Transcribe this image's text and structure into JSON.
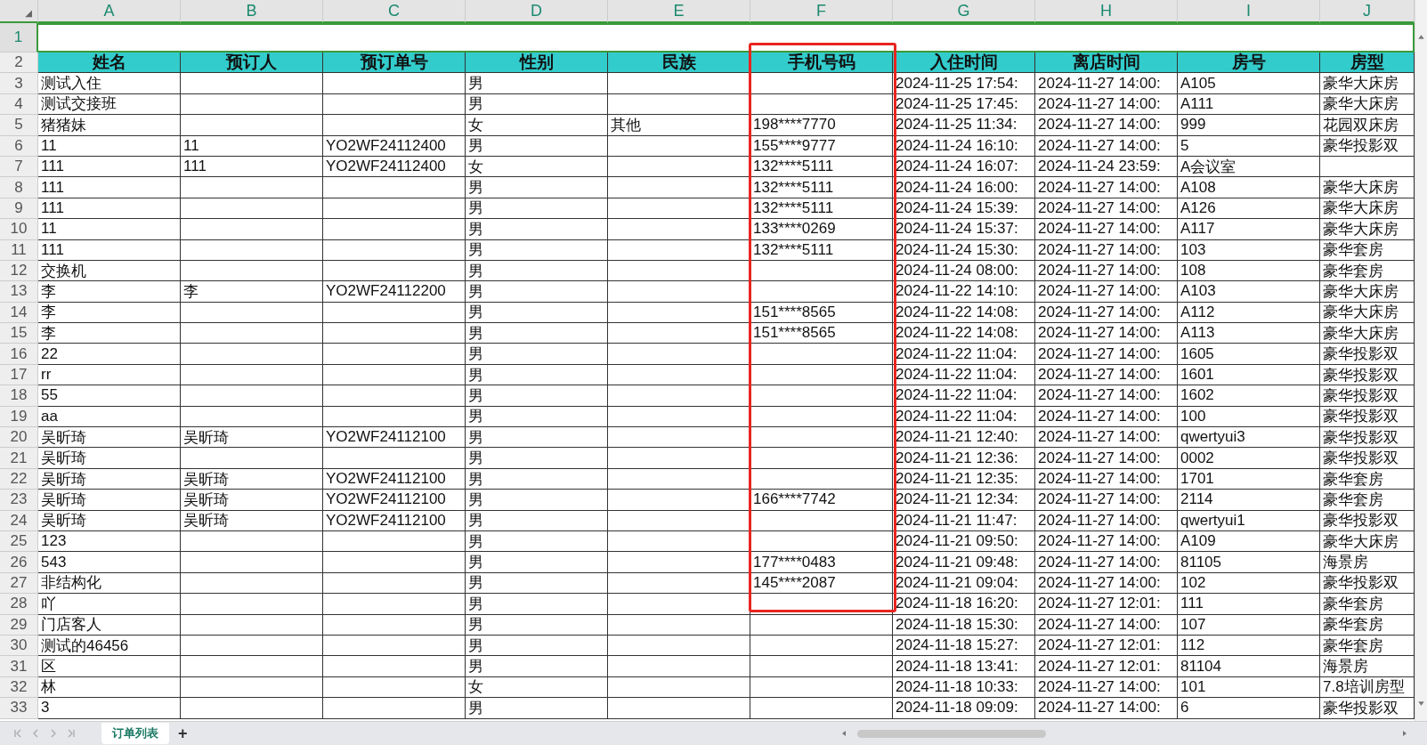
{
  "corner": "◢",
  "column_letters": [
    {
      "label": "A"
    },
    {
      "label": "B"
    },
    {
      "label": "C"
    },
    {
      "label": "D"
    },
    {
      "label": "E"
    },
    {
      "label": "F"
    },
    {
      "label": "G"
    },
    {
      "label": "H"
    },
    {
      "label": "I"
    },
    {
      "label": "J"
    }
  ],
  "headers": [
    {
      "label": "姓名"
    },
    {
      "label": "预订人"
    },
    {
      "label": "预订单号"
    },
    {
      "label": "性别"
    },
    {
      "label": "民族"
    },
    {
      "label": "手机号码"
    },
    {
      "label": "入住时间"
    },
    {
      "label": "离店时间"
    },
    {
      "label": "房号"
    },
    {
      "label": "房型"
    }
  ],
  "header_row_number": "2",
  "first_row_number": "1",
  "rows": [
    {
      "n": "3",
      "cells": [
        {
          "text": "测试入住"
        },
        {},
        {},
        {
          "text": "男"
        },
        {},
        {},
        {
          "text": "2024-11-25 17:54:"
        },
        {
          "text": "2024-11-27 14:00:"
        },
        {
          "text": "A105"
        },
        {
          "text": "豪华大床房"
        }
      ]
    },
    {
      "n": "4",
      "cells": [
        {
          "text": "测试交接班"
        },
        {},
        {},
        {
          "text": "男"
        },
        {},
        {},
        {
          "text": "2024-11-25 17:45:"
        },
        {
          "text": "2024-11-27 14:00:"
        },
        {
          "text": "A111"
        },
        {
          "text": "豪华大床房"
        }
      ]
    },
    {
      "n": "5",
      "cells": [
        {
          "text": "猪猪妹"
        },
        {},
        {},
        {
          "text": "女"
        },
        {
          "text": "其他"
        },
        {
          "text": "198****7770"
        },
        {
          "text": "2024-11-25 11:34:"
        },
        {
          "text": "2024-11-27 14:00:"
        },
        {
          "text": "999"
        },
        {
          "text": "花园双床房"
        }
      ]
    },
    {
      "n": "6",
      "cells": [
        {
          "text": "11"
        },
        {
          "text": "11"
        },
        {
          "text": "YO2WF24112400"
        },
        {
          "text": "男"
        },
        {},
        {
          "text": "155****9777"
        },
        {
          "text": "2024-11-24 16:10:"
        },
        {
          "text": "2024-11-27 14:00:"
        },
        {
          "text": "5"
        },
        {
          "text": "豪华投影双"
        }
      ]
    },
    {
      "n": "7",
      "cells": [
        {
          "text": "111"
        },
        {
          "text": "111"
        },
        {
          "text": "YO2WF24112400"
        },
        {
          "text": "女"
        },
        {},
        {
          "text": "132****5111"
        },
        {
          "text": "2024-11-24 16:07:"
        },
        {
          "text": "2024-11-24 23:59:"
        },
        {
          "text": "A会议室"
        },
        {}
      ]
    },
    {
      "n": "8",
      "cells": [
        {
          "text": "111"
        },
        {},
        {},
        {
          "text": "男"
        },
        {},
        {
          "text": "132****5111"
        },
        {
          "text": "2024-11-24 16:00:"
        },
        {
          "text": "2024-11-27 14:00:"
        },
        {
          "text": "A108"
        },
        {
          "text": "豪华大床房"
        }
      ]
    },
    {
      "n": "9",
      "cells": [
        {
          "text": "111"
        },
        {},
        {},
        {
          "text": "男"
        },
        {},
        {
          "text": "132****5111"
        },
        {
          "text": "2024-11-24 15:39:"
        },
        {
          "text": "2024-11-27 14:00:"
        },
        {
          "text": "A126"
        },
        {
          "text": "豪华大床房"
        }
      ]
    },
    {
      "n": "10",
      "cells": [
        {
          "text": "11"
        },
        {},
        {},
        {
          "text": "男"
        },
        {},
        {
          "text": "133****0269"
        },
        {
          "text": "2024-11-24 15:37:"
        },
        {
          "text": "2024-11-27 14:00:"
        },
        {
          "text": "A117"
        },
        {
          "text": "豪华大床房"
        }
      ]
    },
    {
      "n": "11",
      "cells": [
        {
          "text": "111"
        },
        {},
        {},
        {
          "text": "男"
        },
        {},
        {
          "text": "132****5111"
        },
        {
          "text": "2024-11-24 15:30:"
        },
        {
          "text": "2024-11-27 14:00:"
        },
        {
          "text": "103"
        },
        {
          "text": "豪华套房"
        }
      ]
    },
    {
      "n": "12",
      "cells": [
        {
          "text": "交换机"
        },
        {},
        {},
        {
          "text": "男"
        },
        {},
        {},
        {
          "text": "2024-11-24 08:00:"
        },
        {
          "text": "2024-11-27 14:00:"
        },
        {
          "text": "108"
        },
        {
          "text": "豪华套房"
        }
      ]
    },
    {
      "n": "13",
      "cells": [
        {
          "text": "李"
        },
        {
          "text": "李"
        },
        {
          "text": "YO2WF24112200"
        },
        {
          "text": "男"
        },
        {},
        {},
        {
          "text": "2024-11-22 14:10:"
        },
        {
          "text": "2024-11-27 14:00:"
        },
        {
          "text": "A103"
        },
        {
          "text": "豪华大床房"
        }
      ]
    },
    {
      "n": "14",
      "cells": [
        {
          "text": "李"
        },
        {},
        {},
        {
          "text": "男"
        },
        {},
        {
          "text": "151****8565"
        },
        {
          "text": "2024-11-22 14:08:"
        },
        {
          "text": "2024-11-27 14:00:"
        },
        {
          "text": "A112"
        },
        {
          "text": "豪华大床房"
        }
      ]
    },
    {
      "n": "15",
      "cells": [
        {
          "text": "李"
        },
        {},
        {},
        {
          "text": "男"
        },
        {},
        {
          "text": "151****8565"
        },
        {
          "text": "2024-11-22 14:08:"
        },
        {
          "text": "2024-11-27 14:00:"
        },
        {
          "text": "A113"
        },
        {
          "text": "豪华大床房"
        }
      ]
    },
    {
      "n": "16",
      "cells": [
        {
          "text": "22"
        },
        {},
        {},
        {
          "text": "男"
        },
        {},
        {},
        {
          "text": "2024-11-22 11:04:"
        },
        {
          "text": "2024-11-27 14:00:"
        },
        {
          "text": "1605"
        },
        {
          "text": "豪华投影双"
        }
      ]
    },
    {
      "n": "17",
      "cells": [
        {
          "text": "rr"
        },
        {},
        {},
        {
          "text": "男"
        },
        {},
        {},
        {
          "text": "2024-11-22 11:04:"
        },
        {
          "text": "2024-11-27 14:00:"
        },
        {
          "text": "1601"
        },
        {
          "text": "豪华投影双"
        }
      ]
    },
    {
      "n": "18",
      "cells": [
        {
          "text": "55"
        },
        {},
        {},
        {
          "text": "男"
        },
        {},
        {},
        {
          "text": "2024-11-22 11:04:"
        },
        {
          "text": "2024-11-27 14:00:"
        },
        {
          "text": "1602"
        },
        {
          "text": "豪华投影双"
        }
      ]
    },
    {
      "n": "19",
      "cells": [
        {
          "text": "aa"
        },
        {},
        {},
        {
          "text": "男"
        },
        {},
        {},
        {
          "text": "2024-11-22 11:04:"
        },
        {
          "text": "2024-11-27 14:00:"
        },
        {
          "text": "100"
        },
        {
          "text": "豪华投影双"
        }
      ]
    },
    {
      "n": "20",
      "cells": [
        {
          "text": "吴昕琦"
        },
        {
          "text": "吴昕琦"
        },
        {
          "text": "YO2WF24112100"
        },
        {
          "text": "男"
        },
        {},
        {},
        {
          "text": "2024-11-21 12:40:"
        },
        {
          "text": "2024-11-27 14:00:"
        },
        {
          "text": "qwertyui3"
        },
        {
          "text": "豪华投影双"
        }
      ]
    },
    {
      "n": "21",
      "cells": [
        {
          "text": "吴昕琦"
        },
        {},
        {},
        {
          "text": "男"
        },
        {},
        {},
        {
          "text": "2024-11-21 12:36:"
        },
        {
          "text": "2024-11-27 14:00:"
        },
        {
          "text": "0002"
        },
        {
          "text": "豪华投影双"
        }
      ]
    },
    {
      "n": "22",
      "cells": [
        {
          "text": "吴昕琦"
        },
        {
          "text": "吴昕琦"
        },
        {
          "text": "YO2WF24112100"
        },
        {
          "text": "男"
        },
        {},
        {},
        {
          "text": "2024-11-21 12:35:"
        },
        {
          "text": "2024-11-27 14:00:"
        },
        {
          "text": "1701"
        },
        {
          "text": "豪华套房"
        }
      ]
    },
    {
      "n": "23",
      "cells": [
        {
          "text": "吴昕琦"
        },
        {
          "text": "吴昕琦"
        },
        {
          "text": "YO2WF24112100"
        },
        {
          "text": "男"
        },
        {},
        {
          "text": "166****7742"
        },
        {
          "text": "2024-11-21 12:34:"
        },
        {
          "text": "2024-11-27 14:00:"
        },
        {
          "text": "2114"
        },
        {
          "text": "豪华套房"
        }
      ]
    },
    {
      "n": "24",
      "cells": [
        {
          "text": "吴昕琦"
        },
        {
          "text": "吴昕琦"
        },
        {
          "text": "YO2WF24112100"
        },
        {
          "text": "男"
        },
        {},
        {},
        {
          "text": "2024-11-21 11:47:"
        },
        {
          "text": "2024-11-27 14:00:"
        },
        {
          "text": "qwertyui1"
        },
        {
          "text": "豪华投影双"
        }
      ]
    },
    {
      "n": "25",
      "cells": [
        {
          "text": "123"
        },
        {},
        {},
        {
          "text": "男"
        },
        {},
        {},
        {
          "text": "2024-11-21 09:50:"
        },
        {
          "text": "2024-11-27 14:00:"
        },
        {
          "text": "A109"
        },
        {
          "text": "豪华大床房"
        }
      ]
    },
    {
      "n": "26",
      "cells": [
        {
          "text": "543"
        },
        {},
        {},
        {
          "text": "男"
        },
        {},
        {
          "text": "177****0483"
        },
        {
          "text": "2024-11-21 09:48:"
        },
        {
          "text": "2024-11-27 14:00:"
        },
        {
          "text": "81105"
        },
        {
          "text": "海景房"
        }
      ]
    },
    {
      "n": "27",
      "cells": [
        {
          "text": "非结构化"
        },
        {},
        {},
        {
          "text": "男"
        },
        {},
        {
          "text": "145****2087"
        },
        {
          "text": "2024-11-21 09:04:"
        },
        {
          "text": "2024-11-27 14:00:"
        },
        {
          "text": "102"
        },
        {
          "text": "豪华投影双"
        }
      ]
    },
    {
      "n": "28",
      "cells": [
        {
          "text": "吖"
        },
        {},
        {},
        {
          "text": "男"
        },
        {},
        {},
        {
          "text": "2024-11-18 16:20:"
        },
        {
          "text": "2024-11-27 12:01:"
        },
        {
          "text": "111"
        },
        {
          "text": "豪华套房"
        }
      ]
    },
    {
      "n": "29",
      "cells": [
        {
          "text": "门店客人"
        },
        {},
        {},
        {
          "text": "男"
        },
        {},
        {},
        {
          "text": "2024-11-18 15:30:"
        },
        {
          "text": "2024-11-27 14:00:"
        },
        {
          "text": "107"
        },
        {
          "text": "豪华套房"
        }
      ]
    },
    {
      "n": "30",
      "cells": [
        {
          "text": "测试的46456"
        },
        {},
        {},
        {
          "text": "男"
        },
        {},
        {},
        {
          "text": "2024-11-18 15:27:"
        },
        {
          "text": "2024-11-27 12:01:"
        },
        {
          "text": "112"
        },
        {
          "text": "豪华套房"
        }
      ]
    },
    {
      "n": "31",
      "cells": [
        {
          "text": "区"
        },
        {},
        {},
        {
          "text": "男"
        },
        {},
        {},
        {
          "text": "2024-11-18 13:41:"
        },
        {
          "text": "2024-11-27 12:01:"
        },
        {
          "text": "81104"
        },
        {
          "text": "海景房"
        }
      ]
    },
    {
      "n": "32",
      "cells": [
        {
          "text": "林"
        },
        {},
        {},
        {
          "text": "女"
        },
        {},
        {},
        {
          "text": "2024-11-18 10:33:"
        },
        {
          "text": "2024-11-27 14:00:"
        },
        {
          "text": "101"
        },
        {
          "text": "7.8培训房型"
        }
      ]
    },
    {
      "n": "33",
      "cells": [
        {
          "text": "3"
        },
        {},
        {},
        {
          "text": "男"
        },
        {},
        {},
        {
          "text": "2024-11-18 09:09:"
        },
        {
          "text": "2024-11-27 14:00:"
        },
        {
          "text": "6"
        },
        {
          "text": "豪华投影双"
        }
      ]
    }
  ],
  "sheet_tabs": [
    {
      "label": "订单列表",
      "selected": true
    }
  ],
  "add_sheet": "+"
}
